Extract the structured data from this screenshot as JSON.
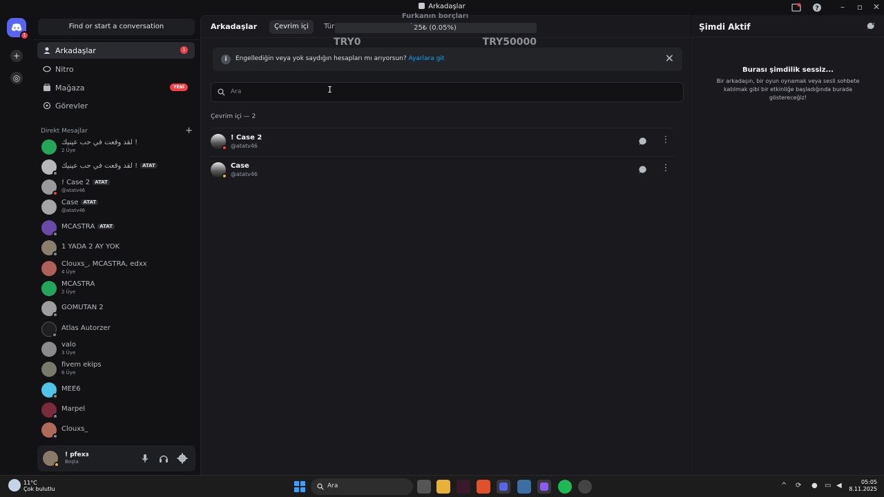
{
  "window": {
    "title": "Arkadaşlar"
  },
  "sidebar": {
    "search_label": "Find or start a conversation",
    "nav": [
      {
        "label": "Arkadaşlar",
        "badge": "1"
      },
      {
        "label": "Nitro"
      },
      {
        "label": "Mağaza",
        "badge": "YENİ"
      },
      {
        "label": "Görevler"
      }
    ],
    "dm_header": "Direkt Mesajlar",
    "dms": [
      {
        "name": "لقد وقعت في حب عينيك !",
        "sub": "2 Üye",
        "tag": ""
      },
      {
        "name": "لقد وقعت في حب عينيك !",
        "sub": "",
        "tag": "ATAT"
      },
      {
        "name": "! Case 2",
        "sub": "@atatv46",
        "tag": "ATAT"
      },
      {
        "name": "Case",
        "sub": "@atatv46",
        "tag": "ATAT"
      },
      {
        "name": "MCASTRA",
        "sub": "",
        "tag": "ATAT"
      },
      {
        "name": "1 YADA 2 AY YOK",
        "sub": "",
        "tag": ""
      },
      {
        "name": "Clouxs_, MCASTRA, edxx",
        "sub": "4 Üye",
        "tag": ""
      },
      {
        "name": "MCASTRA",
        "sub": "2 Üye",
        "tag": ""
      },
      {
        "name": "GOMUTAN 2",
        "sub": "",
        "tag": ""
      },
      {
        "name": "Atlas Autorzer",
        "sub": "",
        "tag": ""
      },
      {
        "name": "valo",
        "sub": "3 Üye",
        "tag": ""
      },
      {
        "name": "fivem ekips",
        "sub": "6 Üye",
        "tag": ""
      },
      {
        "name": "MEE6",
        "sub": "",
        "tag": ""
      },
      {
        "name": "Marpel",
        "sub": "",
        "tag": ""
      },
      {
        "name": "Clouxs_",
        "sub": "",
        "tag": ""
      }
    ]
  },
  "user": {
    "name": "! pfexз",
    "status": "Boşta"
  },
  "topbar": {
    "title": "Arkadaşlar",
    "tabs": [
      "Çevrim içi",
      "Tür"
    ]
  },
  "overlay": {
    "title": "Furkanın borçları",
    "amount": "25₺ (0.05%)",
    "progress": 0.05,
    "min": "TRY0",
    "max": "TRY50000"
  },
  "notice": {
    "text": "Engellediğin veya yok saydığın hesapları mı arıyorsun?",
    "link": "Ayarlara git"
  },
  "search": {
    "placeholder": "Ara"
  },
  "online_label": "Çevrim içi — 2",
  "friends": [
    {
      "name": "! Case 2",
      "username": "@atatv46"
    },
    {
      "name": "Case",
      "username": "@atatv46"
    }
  ],
  "active_now": {
    "title": "Şimdi Aktif",
    "quiet": "Burası şimdilik sessiz...",
    "desc": "Bir arkadaşın, bir oyun oynamak veya sesli sohbete katılmak gibi bir etkinliğe başladığında burada göstereceğiz!"
  },
  "taskbar": {
    "weather_temp": "11°C",
    "weather_desc": "Çok bulutlu",
    "search": "Ara",
    "time": "05:05",
    "date": "8.11.2025"
  },
  "colors": {
    "accent": "#5865f2",
    "danger": "#f23f43",
    "link": "#00a8fc"
  }
}
